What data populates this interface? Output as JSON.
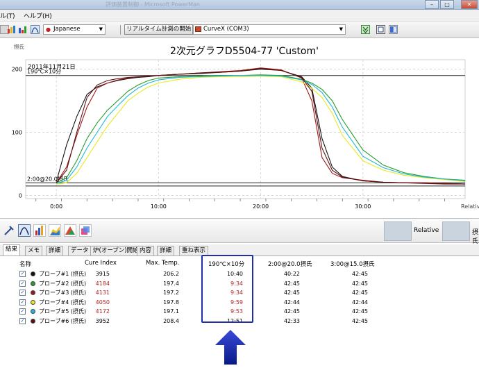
{
  "window": {
    "title": "評価装置制御 - Microsoft PowerMan"
  },
  "menu": {
    "items": [
      "ル(T)",
      "ヘルプ(H)"
    ]
  },
  "toolbar": {
    "language": "Japanese",
    "realtime_button": "リアルタイム計測の開始",
    "device": "CurveX (COM3)"
  },
  "chart": {
    "title": "2次元グラフD5504-77 'Custom'",
    "date": "2011年11月21日",
    "y_unit": "摂氏",
    "x_unit": "Relative",
    "ref_label_190": "190℃×10分",
    "ref_label_20": "2:00@20.0摂氏"
  },
  "chart_data": {
    "type": "line",
    "title": "2次元グラフD5504-77 'Custom'",
    "xlabel": "Relative",
    "ylabel": "摂氏",
    "x_ticks": [
      "0:00",
      "10:00",
      "20:00",
      "30:00"
    ],
    "y_ticks": [
      0,
      100,
      200
    ],
    "xlim": [
      -3,
      40
    ],
    "ylim": [
      -5,
      215
    ],
    "reference_lines": [
      {
        "label": "190℃×10分",
        "y": 190
      },
      {
        "label": "2:00@20.0摂氏",
        "y": 20
      },
      {
        "label": "",
        "y": 15
      }
    ],
    "x_minutes": [
      0,
      1,
      2,
      3,
      4,
      5,
      6,
      7,
      8,
      9,
      10,
      12,
      14,
      16,
      18,
      20,
      22,
      24,
      25,
      26,
      27,
      28,
      30,
      32,
      34,
      36,
      38,
      40
    ],
    "series": [
      {
        "name": "プローブ#1 (摂氏)",
        "color": "#111111",
        "values": [
          22,
          80,
          125,
          160,
          172,
          178,
          182,
          185,
          187,
          188,
          190,
          192,
          193,
          195,
          197,
          200,
          198,
          188,
          170,
          90,
          45,
          30,
          23,
          21,
          20,
          20,
          19,
          18
        ]
      },
      {
        "name": "プローブ#2 (摂氏)",
        "color": "#2a9a2a",
        "values": [
          20,
          28,
          55,
          90,
          115,
          135,
          150,
          165,
          175,
          182,
          186,
          188,
          189,
          190,
          190,
          191,
          190,
          184,
          178,
          168,
          150,
          120,
          72,
          48,
          36,
          30,
          26,
          24
        ]
      },
      {
        "name": "プローブ#3 (摂氏)",
        "color": "#9a1a1a",
        "values": [
          20,
          45,
          95,
          140,
          170,
          178,
          183,
          186,
          188,
          189,
          190,
          192,
          194,
          196,
          198,
          202,
          199,
          186,
          150,
          60,
          35,
          28,
          24,
          21,
          20,
          20,
          19,
          18
        ]
      },
      {
        "name": "プローブ#4 (摂氏)",
        "color": "#e8e820",
        "values": [
          18,
          20,
          35,
          60,
          85,
          110,
          130,
          150,
          162,
          172,
          178,
          184,
          187,
          188,
          188,
          189,
          188,
          180,
          170,
          155,
          130,
          95,
          55,
          40,
          32,
          28,
          25,
          22
        ]
      },
      {
        "name": "プローブ#5 (摂氏)",
        "color": "#20b8d8",
        "values": [
          19,
          24,
          45,
          75,
          100,
          125,
          142,
          158,
          170,
          178,
          183,
          187,
          188,
          189,
          190,
          190,
          189,
          183,
          176,
          163,
          140,
          108,
          62,
          44,
          34,
          29,
          26,
          23
        ]
      },
      {
        "name": "プローブ#6 (摂氏)",
        "color": "#5a1010",
        "values": [
          20,
          40,
          100,
          155,
          175,
          182,
          185,
          187,
          188,
          189,
          190,
          192,
          194,
          195,
          197,
          201,
          198,
          187,
          165,
          75,
          40,
          29,
          23,
          21,
          20,
          19,
          18,
          18
        ]
      }
    ]
  },
  "bottombar": {
    "relative_label": "Relative",
    "unit_label": "摂氏"
  },
  "tabs": [
    "結果",
    "メモ",
    "詳細",
    "データ",
    "炉(オーブン)開始",
    "内容",
    "詳細",
    "重ね表示"
  ],
  "results": {
    "headers": [
      "名称",
      "Cure Index",
      "Max. Temp.",
      "190℃×10分",
      "2:00@20.0摂氏",
      "3:00@15.0摂氏"
    ],
    "rows": [
      {
        "name": "プローブ#1 (摂氏)",
        "cure": "3915",
        "max": "206.2",
        "c190": "10:40",
        "c2": "40:22",
        "c3": "42:45",
        "color": "#111111",
        "red": false
      },
      {
        "name": "プローブ#2 (摂氏)",
        "cure": "4184",
        "max": "197.4",
        "c190": "9:34",
        "c2": "42:45",
        "c3": "42:45",
        "color": "#2a9a2a",
        "red": true
      },
      {
        "name": "プローブ#3 (摂氏)",
        "cure": "4131",
        "max": "197.2",
        "c190": "9:34",
        "c2": "42:45",
        "c3": "42:45",
        "color": "#9a1a1a",
        "red": true
      },
      {
        "name": "プローブ#4 (摂氏)",
        "cure": "4050",
        "max": "197.8",
        "c190": "9:59",
        "c2": "42:44",
        "c3": "42:44",
        "color": "#e8e820",
        "red": true
      },
      {
        "name": "プローブ#5 (摂氏)",
        "cure": "4172",
        "max": "197.1",
        "c190": "9:53",
        "c2": "42:45",
        "c3": "42:45",
        "color": "#20b8d8",
        "red": true
      },
      {
        "name": "プローブ#6 (摂氏)",
        "cure": "3952",
        "max": "208.4",
        "c190": "12:51",
        "c2": "42:33",
        "c3": "42:45",
        "color": "#5a1010",
        "red": false
      }
    ]
  }
}
